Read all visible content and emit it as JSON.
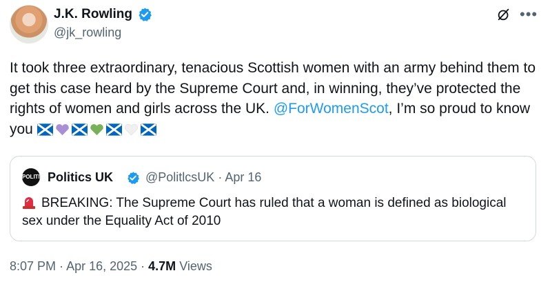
{
  "author": {
    "name": "J.K. Rowling",
    "handle": "@jk_rowling"
  },
  "tweet": {
    "text_part1": "It took three extraordinary, tenacious Scottish women with an army behind them to get this case heard by the Supreme Court and, in winning, they’ve protected the rights of women and girls across the UK.",
    "mention": "@ForWomenScot",
    "text_part2": ", I’m so proud to know you",
    "emojis": [
      "scotland-flag",
      "purple-heart",
      "scotland-flag",
      "green-heart",
      "scotland-flag",
      "white-heart",
      "scotland-flag"
    ]
  },
  "quoted": {
    "name": "Politics UK",
    "avatar_text": "POLITICS UK",
    "handle": "@PolitlcsUK",
    "separator": "·",
    "date": "Apr 16",
    "text": "BREAKING: The Supreme Court has ruled that a woman is defined as biological sex under the Equality Act of 2010"
  },
  "meta": {
    "time": "8:07 PM",
    "date": "Apr 16, 2025",
    "views_count": "4.7M",
    "views_label": "Views"
  },
  "colors": {
    "text": "#0f1419",
    "secondary": "#536471",
    "accent": "#1d9bf0",
    "border": "#cfd9de"
  }
}
